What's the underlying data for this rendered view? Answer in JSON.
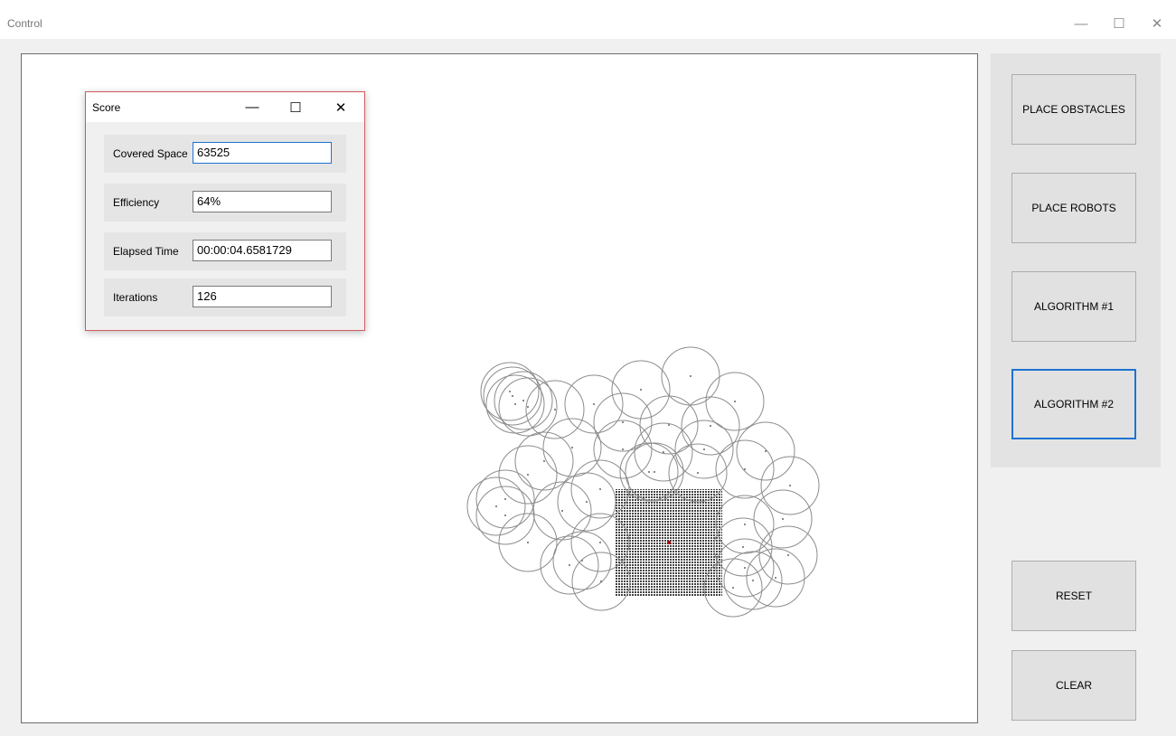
{
  "main_window": {
    "title": "Control",
    "minimize_glyph": "—",
    "maximize_glyph": "☐",
    "close_glyph": "✕"
  },
  "buttons": {
    "place_obstacles": "PLACE OBSTACLES",
    "place_robots": "PLACE ROBOTS",
    "algorithm1": "ALGORITHM #1",
    "algorithm2": "ALGORITHM #2",
    "reset": "RESET",
    "clear": "CLEAR"
  },
  "score_window": {
    "title": "Score",
    "minimize_glyph": "—",
    "maximize_glyph": "☐",
    "close_glyph": "✕",
    "rows": [
      {
        "label": "Covered Space",
        "value": "63525"
      },
      {
        "label": "Efficiency",
        "value": "64%"
      },
      {
        "label": "Elapsed Time",
        "value": "00:00:04.6581729"
      },
      {
        "label": "Iterations",
        "value": "126"
      }
    ]
  },
  "colors": {
    "accent": "#1e73d2",
    "dialog_border": "#d05a5a",
    "robot_circle": "#8c8c8c",
    "obstacle": "#555555",
    "target": "#b00000"
  }
}
